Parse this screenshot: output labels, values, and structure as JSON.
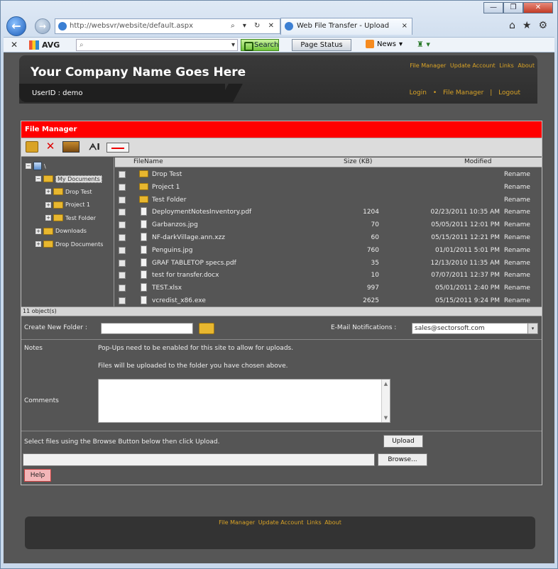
{
  "browser": {
    "address": "http://websvr/website/default.aspx",
    "tabs": [
      {
        "label": "Web File Transfer - Upload",
        "close": "×"
      }
    ],
    "address_tools": "⌕ ▾ ↻ ✕",
    "window_buttons": [
      "—",
      "❐",
      "✕"
    ],
    "chrome_icons": [
      "⌂",
      "★",
      "⚙"
    ],
    "nav_back": "←",
    "nav_fwd": "→",
    "cmd_close": "✕",
    "avg_label": "AVG",
    "search_placeholder": "",
    "search_dd": "▾",
    "search_btn": "Search",
    "page_status_btn": "Page Status",
    "news_label": "News",
    "news_dd": "▾",
    "extra_icon": "♜ ▾"
  },
  "header": {
    "company": "Your Company Name Goes Here",
    "top_links": [
      "File Manager",
      "Update Account",
      "Links",
      "About"
    ],
    "user_id": "UserID : demo",
    "links": [
      "Login",
      "File Manager",
      "Logout"
    ],
    "bullet": "•",
    "pipe": "|"
  },
  "file_manager": {
    "title": "File Manager",
    "toolbar": {
      "delete": "✕",
      "rename": "ᗅI"
    },
    "tree": [
      {
        "label": "\\",
        "level": 0,
        "type": "drive",
        "expander": "−"
      },
      {
        "label": "My Documents",
        "level": 1,
        "type": "folder",
        "expander": "−",
        "selected": true
      },
      {
        "label": "Drop Test",
        "level": 2,
        "type": "folder",
        "expander": "+"
      },
      {
        "label": "Project 1",
        "level": 2,
        "type": "folder",
        "expander": "+"
      },
      {
        "label": "Test Folder",
        "level": 2,
        "type": "folder",
        "expander": "+"
      },
      {
        "label": "Downloads",
        "level": 1,
        "type": "folder",
        "expander": "+"
      },
      {
        "label": "Drop Documents",
        "level": 1,
        "type": "folder",
        "expander": "+"
      }
    ],
    "columns": {
      "name": "FileName",
      "size": "Size (KB)",
      "modified": "Modified"
    },
    "files": [
      {
        "name": "Drop Test",
        "type": "folder",
        "size": "",
        "modified": "",
        "action": "Rename"
      },
      {
        "name": "Project 1",
        "type": "folder",
        "size": "",
        "modified": "",
        "action": "Rename"
      },
      {
        "name": "Test Folder",
        "type": "folder",
        "size": "",
        "modified": "",
        "action": "Rename"
      },
      {
        "name": "DeploymentNotesInventory.pdf",
        "type": "file",
        "size": "1204",
        "modified": "02/23/2011 10:35 AM",
        "action": "Rename"
      },
      {
        "name": "Garbanzos.jpg",
        "type": "file",
        "size": "70",
        "modified": "05/05/2011 12:01 PM",
        "action": "Rename"
      },
      {
        "name": "NF-darkVillage.ann.xzz",
        "type": "file",
        "size": "60",
        "modified": "05/15/2011 12:21 PM",
        "action": "Rename"
      },
      {
        "name": "Penguins.jpg",
        "type": "file",
        "size": "760",
        "modified": "01/01/2011 5:01 PM",
        "action": "Rename"
      },
      {
        "name": "GRAF TABLETOP specs.pdf",
        "type": "file",
        "size": "35",
        "modified": "12/13/2010 11:35 AM",
        "action": "Rename"
      },
      {
        "name": "test for transfer.docx",
        "type": "file",
        "size": "10",
        "modified": "07/07/2011 12:37 PM",
        "action": "Rename"
      },
      {
        "name": "TEST.xlsx",
        "type": "file",
        "size": "997",
        "modified": "05/01/2011 2:40 PM",
        "action": "Rename"
      },
      {
        "name": "vcredist_x86.exe",
        "type": "file",
        "size": "2625",
        "modified": "05/15/2011 9:24 PM",
        "action": "Rename"
      }
    ],
    "status": "11 object(s)",
    "create_folder_label": "Create New Folder :",
    "create_folder_value": "",
    "email_label": "E-Mail Notifications :",
    "email_value": "sales@sectorsoft.com",
    "email_dd": "▾",
    "notes_label": "Notes",
    "notes_line1": "Pop-Ups need to be enabled for this site to allow for uploads.",
    "notes_line2": "Files will be uploaded to the folder you have chosen above.",
    "comments_label": "Comments",
    "scroll_up": "▲",
    "scroll_down": "▼",
    "upload_hint": "Select files using the Browse Button below then click Upload.",
    "upload_btn": "Upload",
    "browse_btn": "Browse...",
    "help_btn": "Help"
  },
  "footer": {
    "links": [
      "File Manager",
      "Update Account",
      "Links",
      "About"
    ]
  }
}
